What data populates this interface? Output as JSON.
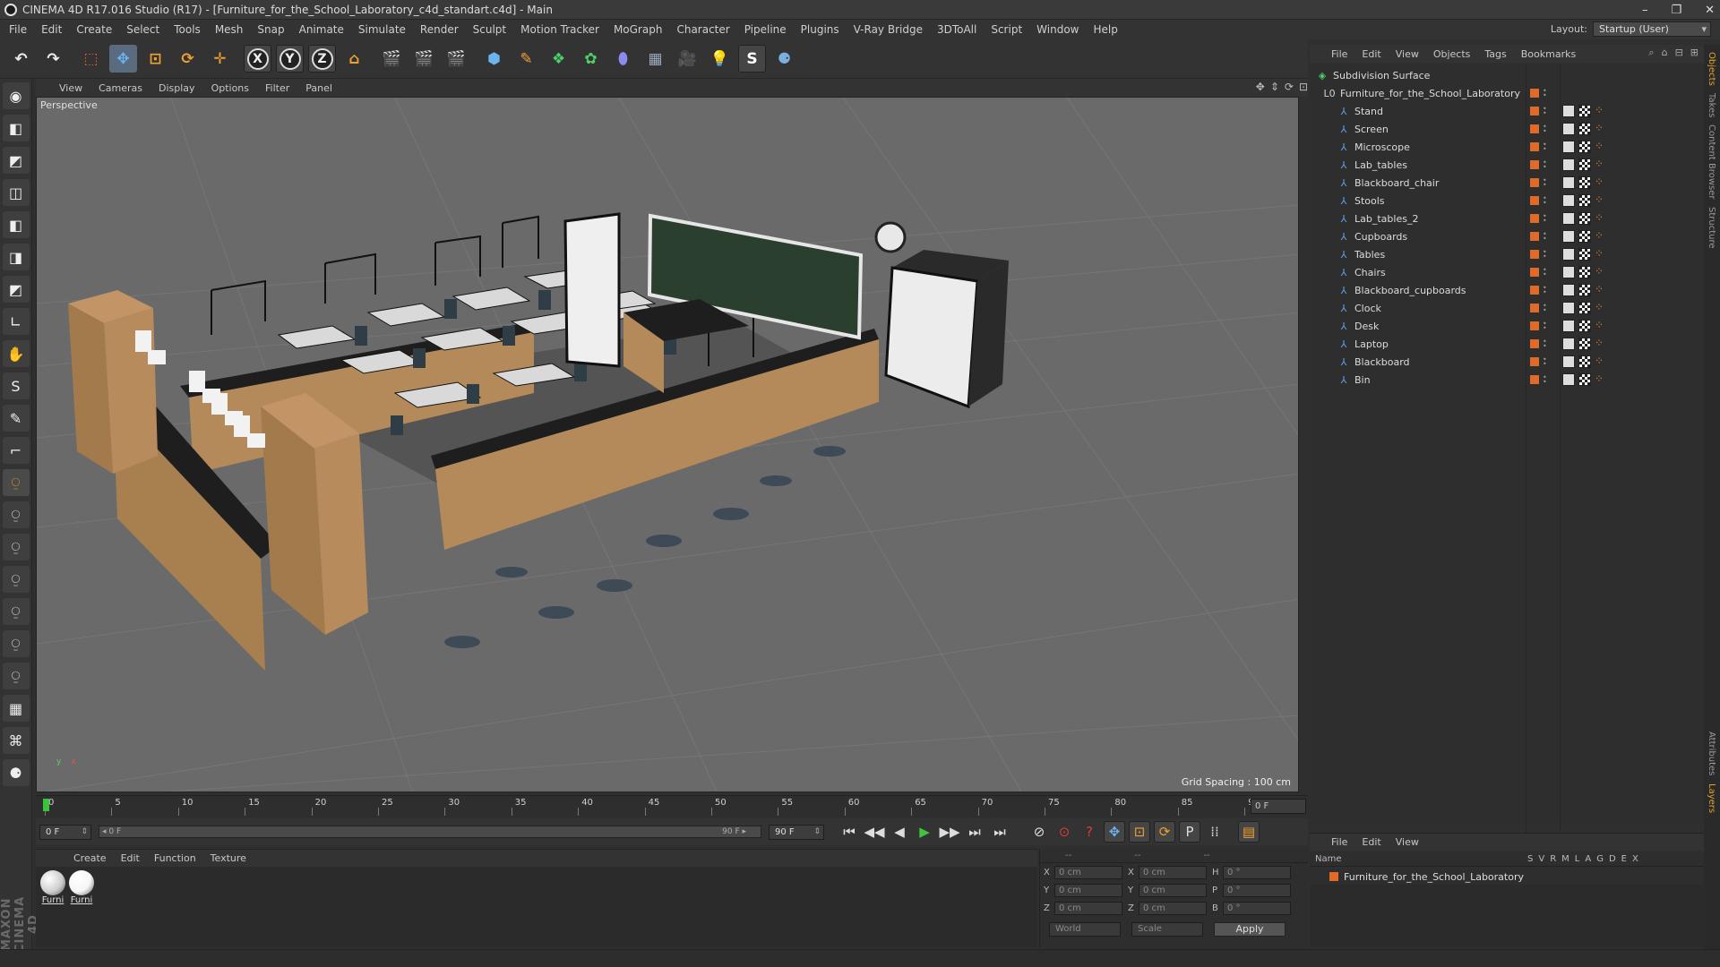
{
  "window": {
    "title": "CINEMA 4D R17.016 Studio (R17) - [Furniture_for_the_School_Laboratory_c4d_standart.c4d] - Main",
    "controls": [
      "–",
      "❐",
      "✕"
    ]
  },
  "menubar": [
    "File",
    "Edit",
    "Create",
    "Select",
    "Tools",
    "Mesh",
    "Snap",
    "Animate",
    "Simulate",
    "Render",
    "Sculpt",
    "Motion Tracker",
    "MoGraph",
    "Character",
    "Pipeline",
    "Plugins",
    "V-Ray Bridge",
    "3DToAll",
    "Script",
    "Window",
    "Help"
  ],
  "layout": {
    "label": "Layout:",
    "value": "Startup (User)"
  },
  "toolbar": {
    "undo": "↶",
    "redo": "↷",
    "select": "⬚",
    "move": "✥",
    "scale": "⊡",
    "rotate": "⟳",
    "add": "✛",
    "x": "X",
    "y": "Y",
    "z": "Z",
    "coord": "⌂",
    "r1": "🎬",
    "r2": "🎬",
    "r3": "🎬",
    "cube": "⬢",
    "pen": "✎",
    "gen": "❖",
    "deform": "✿",
    "env": "⬮",
    "grid": "▦",
    "cam": "🎥",
    "light": "💡",
    "cloth": "S",
    "py": "⚈"
  },
  "lefttools": [
    "◉",
    "◧",
    "◩",
    "◫",
    "◧",
    "◨",
    "◩",
    "∟",
    "✋",
    "S",
    "✎",
    "⌐",
    "⍜",
    "⍜",
    "⍜",
    "⍜",
    "⍜",
    "⍜",
    "⍜",
    "▦",
    "⌘",
    "⚈"
  ],
  "brand": "MAXON CINEMA 4D",
  "viewport": {
    "menu": [
      "View",
      "Cameras",
      "Display",
      "Options",
      "Filter",
      "Panel"
    ],
    "icons": [
      "✥",
      "⇕",
      "⟳",
      "⊡"
    ],
    "label": "Perspective",
    "grid_spacing": "Grid Spacing : 100 cm",
    "axis_y": "y",
    "axis_x": "x"
  },
  "timeline": {
    "ticks": [
      "0",
      "5",
      "10",
      "15",
      "20",
      "25",
      "30",
      "35",
      "40",
      "45",
      "50",
      "55",
      "60",
      "65",
      "70",
      "75",
      "80",
      "85",
      "90"
    ],
    "current_frame": "0 F",
    "start": "0 F",
    "end": "90 F",
    "slider_left": "◂ 0 F",
    "slider_right": "90 F ▸"
  },
  "transport": [
    "⏮",
    "◀◀",
    "◀",
    "▶",
    "▶▶",
    "⏭",
    "⏭"
  ],
  "transport2": [
    "⊘",
    "⊙",
    "?",
    "✥",
    "⊡",
    "⟳",
    "P",
    "⁞⁞",
    "▤"
  ],
  "materials": {
    "menu": [
      "Create",
      "Edit",
      "Function",
      "Texture"
    ],
    "items": [
      {
        "label": "Furni",
        "color": "#cfcfcf"
      },
      {
        "label": "Furni",
        "color": "#f5f5f5"
      }
    ]
  },
  "coords": {
    "header": [
      "--",
      "--",
      "--"
    ],
    "rows": [
      {
        "a": "X",
        "av": "0 cm",
        "b": "X",
        "bv": "0 cm",
        "c": "H",
        "cv": "0 °"
      },
      {
        "a": "Y",
        "av": "0 cm",
        "b": "Y",
        "bv": "0 cm",
        "c": "P",
        "cv": "0 °"
      },
      {
        "a": "Z",
        "av": "0 cm",
        "b": "Z",
        "bv": "0 cm",
        "c": "B",
        "cv": "0 °"
      }
    ],
    "world": "World",
    "scale": "Scale",
    "apply": "Apply"
  },
  "objects": {
    "menu": [
      "File",
      "Edit",
      "View",
      "Objects",
      "Tags",
      "Bookmarks"
    ],
    "icons": [
      "⌕",
      "⌂",
      "⊟",
      "⊞"
    ],
    "root": "Subdivision Surface",
    "group": "Furniture_for_the_School_Laboratory",
    "items": [
      "Stand",
      "Screen",
      "Microscope",
      "Lab_tables",
      "Blackboard_chair",
      "Stools",
      "Lab_tables_2",
      "Cupboards",
      "Tables",
      "Chairs",
      "Blackboard_cupboards",
      "Clock",
      "Desk",
      "Laptop",
      "Blackboard",
      "Bin"
    ]
  },
  "tabs_right": [
    "Objects",
    "Takes",
    "Content Browser",
    "Structure",
    "Attributes",
    "Layers"
  ],
  "layers": {
    "menu": [
      "File",
      "Edit",
      "View"
    ],
    "header_name": "Name",
    "columns": [
      "S",
      "V",
      "R",
      "M",
      "L",
      "A",
      "G",
      "D",
      "E",
      "X"
    ],
    "row": "Furniture_for_the_School_Laboratory"
  }
}
